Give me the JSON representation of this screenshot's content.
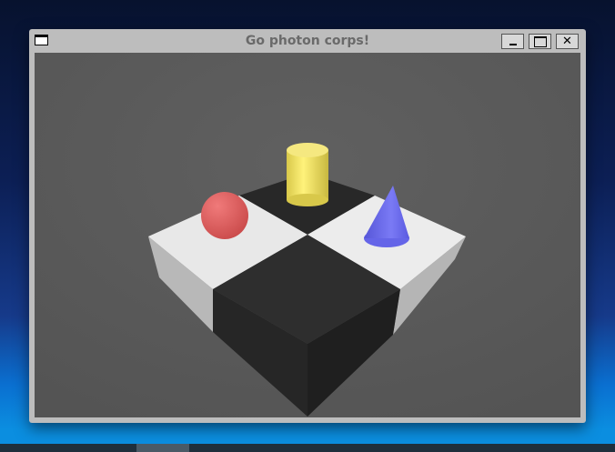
{
  "window": {
    "title": "Go photon corps!",
    "icon": "window-icon",
    "buttons": {
      "minimize": "minimize-icon",
      "maximize": "maximize-icon",
      "close": "close-icon"
    }
  },
  "scene": {
    "objects": [
      "sphere",
      "cylinder",
      "cone",
      "checkerboard-block"
    ],
    "colors": {
      "sphere": "#e05a5a",
      "cylinder": "#f2e36a",
      "cone": "#6f6ff2",
      "floor": "#5a5a5a"
    }
  }
}
